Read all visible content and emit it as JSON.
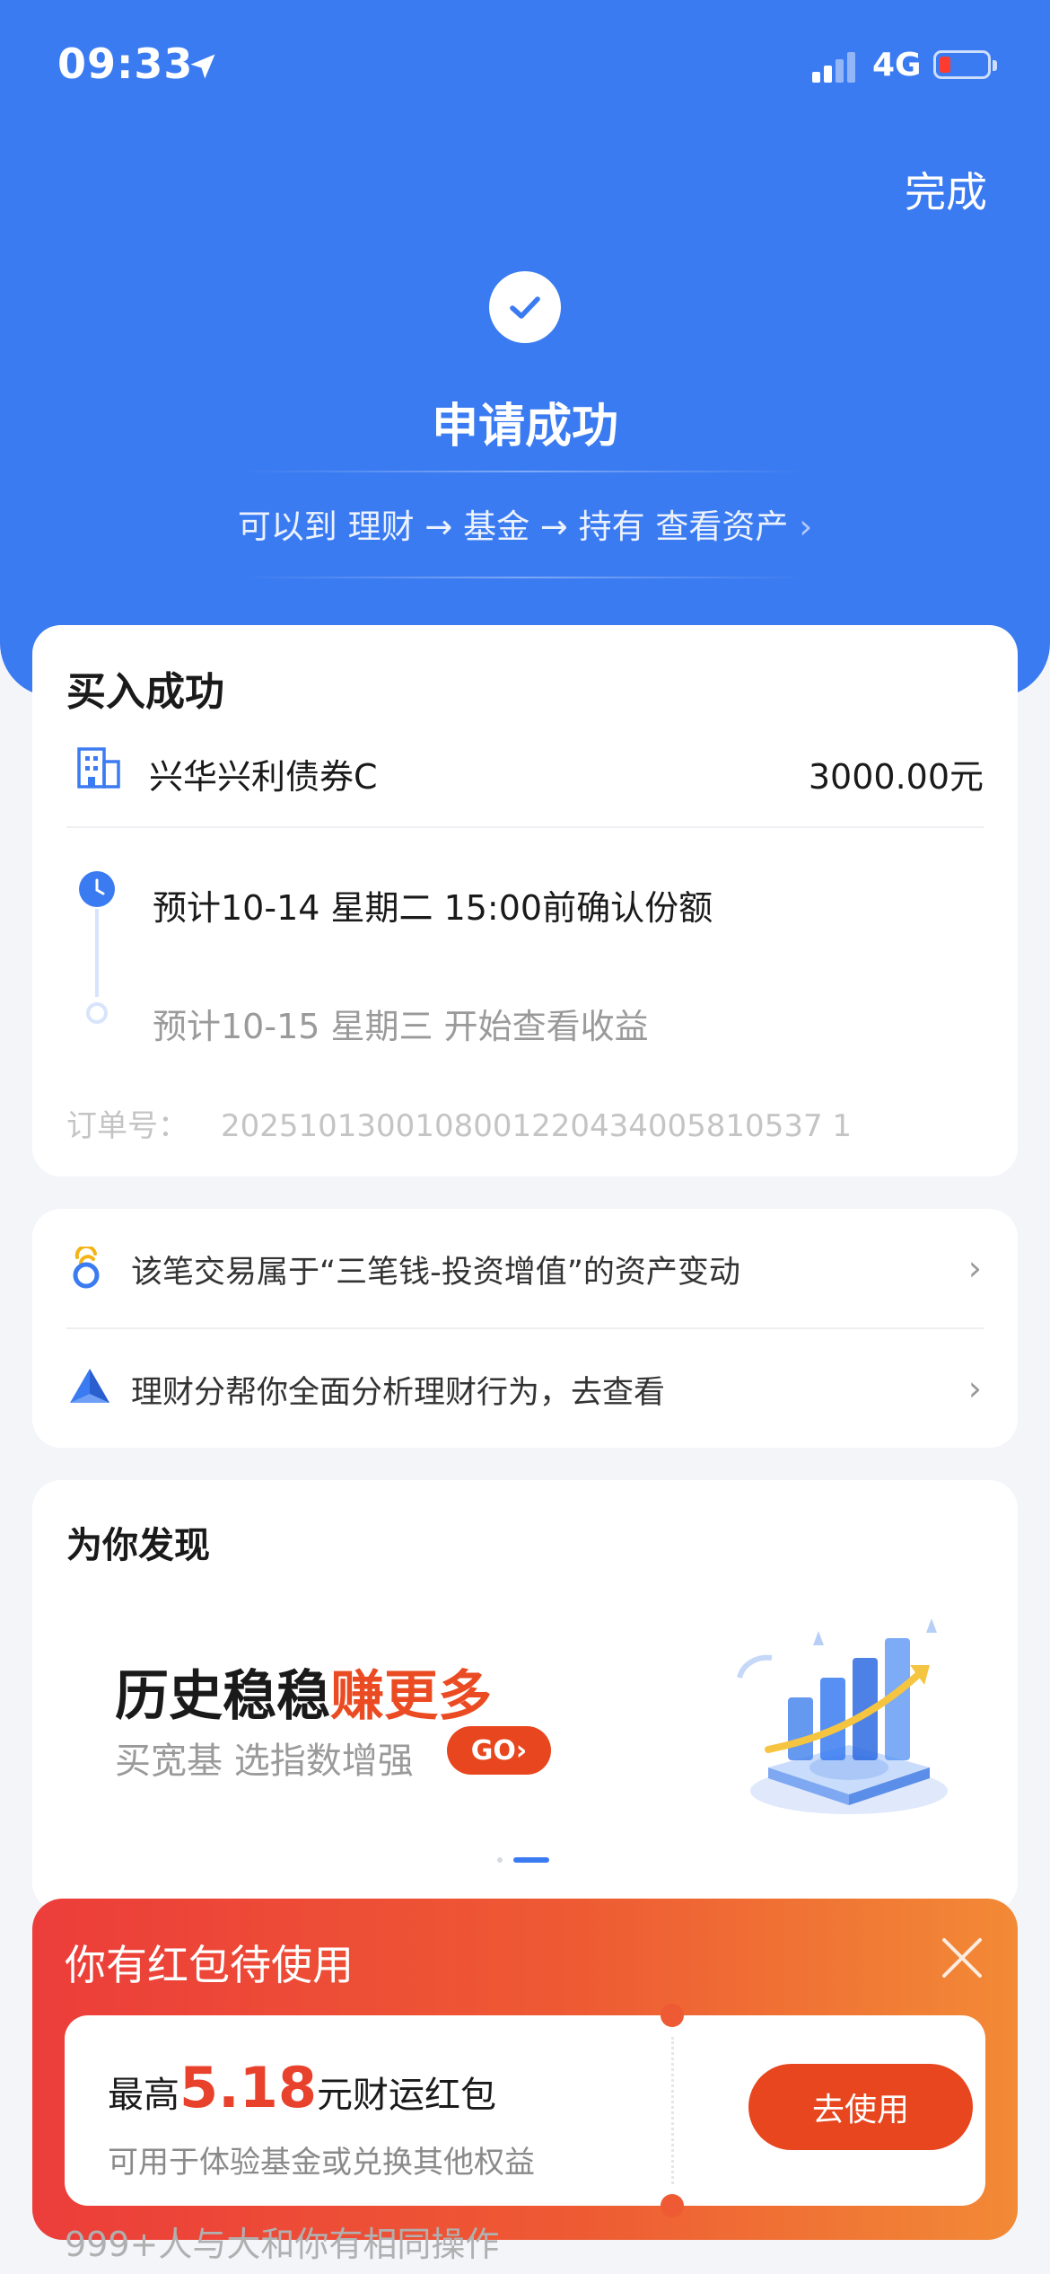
{
  "status_bar": {
    "time": "09:33",
    "network": "4G"
  },
  "header": {
    "done_label": "完成"
  },
  "result": {
    "title": "申请成功",
    "subtitle": "可以到 理财 → 基金 → 持有 查看资产",
    "subtitle_chevron": "›"
  },
  "purchase": {
    "title": "买入成功",
    "fund_name": "兴华兴利债券C",
    "amount": "3000.00元",
    "steps": [
      {
        "text": "预计10-14 星期二 15:00前确认份额"
      },
      {
        "text": "预计10-15 星期三 开始查看收益"
      }
    ],
    "order_label": "订单号：",
    "order_number": "2025101300108001220434005810537 1"
  },
  "links": [
    {
      "text": "该笔交易属于“三笔钱-投资增值”的资产变动",
      "chevron": "›"
    },
    {
      "text": "理财分帮你全面分析理财行为，去查看",
      "chevron": "›"
    }
  ],
  "discover": {
    "title": "为你发现",
    "banner_heading_a": "历史稳稳",
    "banner_heading_b": "赚更多",
    "banner_sub": "买宽基 选指数增强",
    "banner_go": "GO›",
    "page_count": 2,
    "active_page": 2
  },
  "red_packet": {
    "title": "你有红包待使用",
    "prefix": "最高",
    "amount": "5.18",
    "suffix": "元财运红包",
    "desc": "可用于体验基金或兑换其他权益",
    "button": "去使用"
  },
  "peek_text": "999+人与大和你有相同操作",
  "colors": {
    "primary": "#3b7bf1",
    "accent_red": "#e8461e",
    "banner_highlight": "#ea4b22"
  }
}
